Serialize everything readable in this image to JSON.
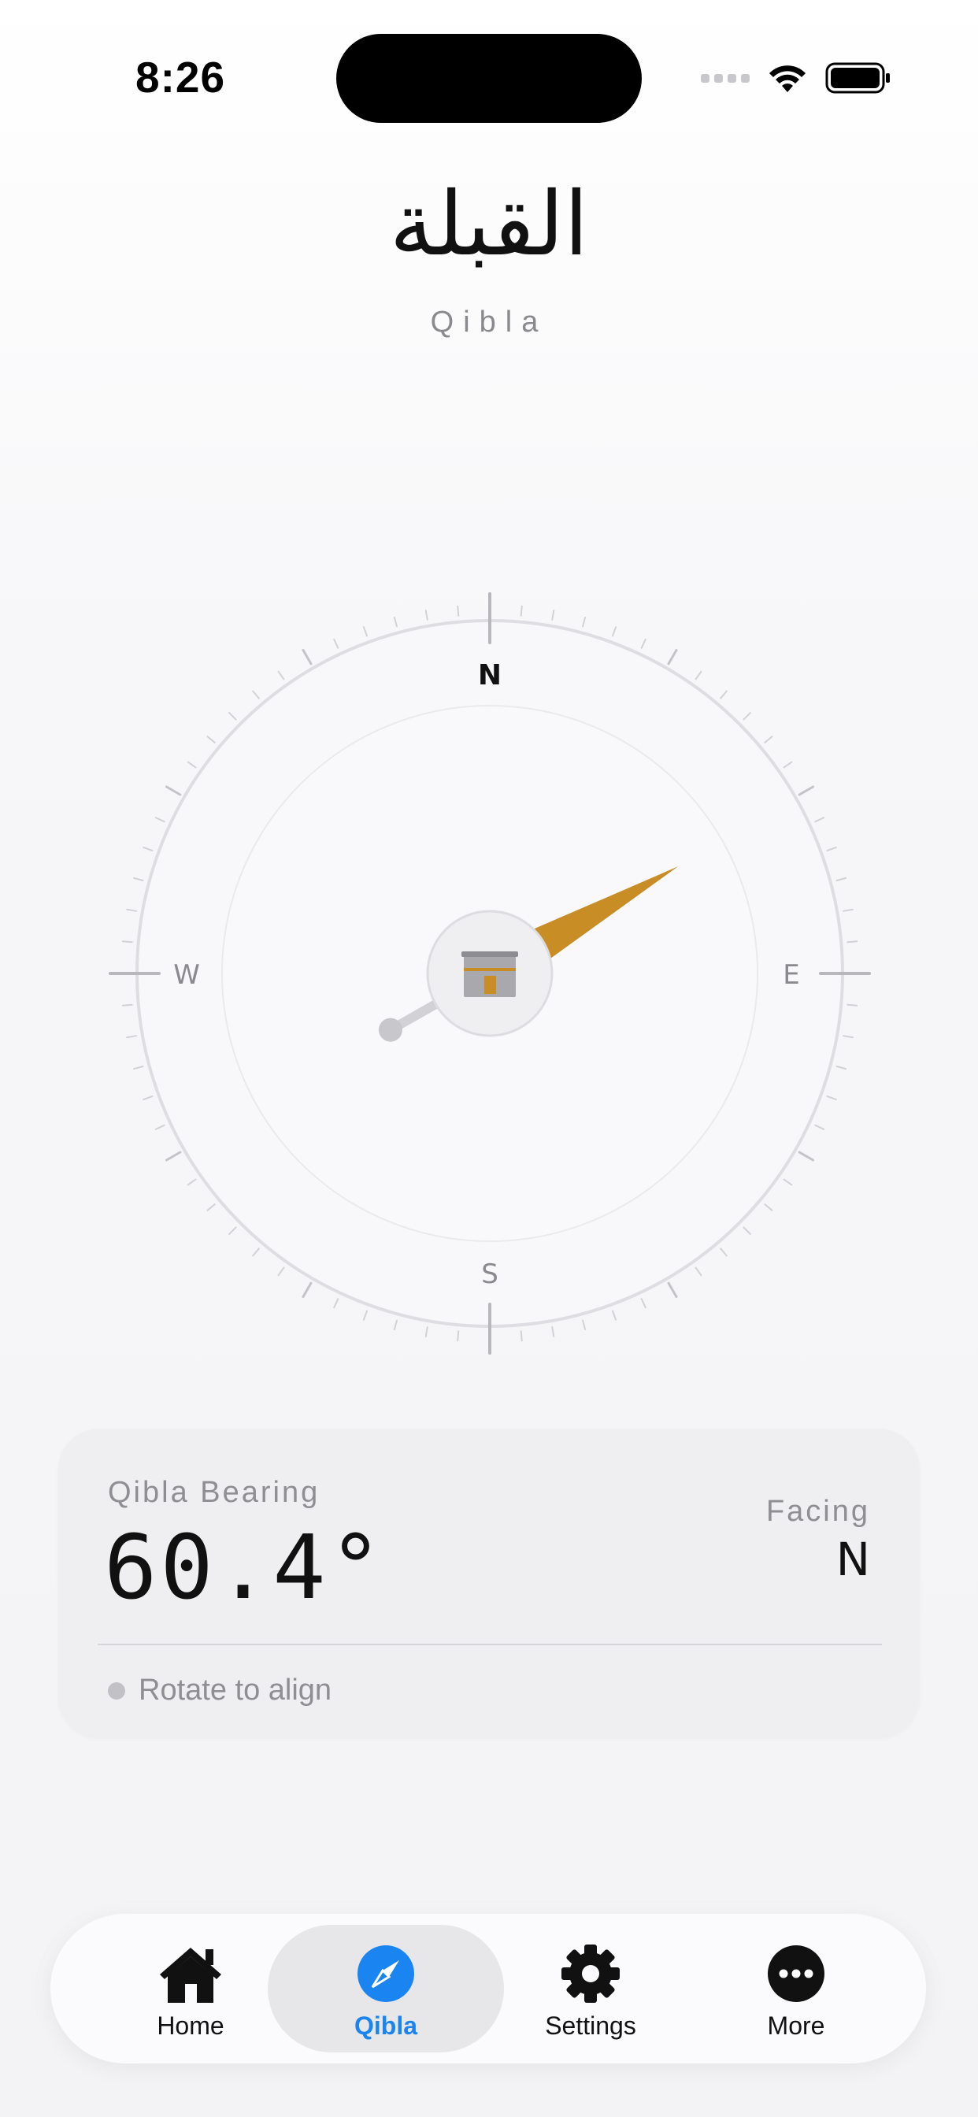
{
  "status_bar": {
    "time": "8:26"
  },
  "header": {
    "title_arabic": "القبلة",
    "title_english": "Qibla"
  },
  "compass": {
    "cardinals": {
      "north": "N",
      "east": "E",
      "south": "S",
      "west": "W"
    },
    "needle_bearing_deg": 60.4,
    "needle_color": "#c98d26"
  },
  "info_card": {
    "bearing_label": "Qibla Bearing",
    "bearing_value": "60.4°",
    "facing_label": "Facing",
    "facing_value": "N",
    "hint_text": "Rotate to align"
  },
  "tab_bar": {
    "active_tab": "Qibla",
    "accent_color": "#1a84f0",
    "items": [
      {
        "label": "Home",
        "icon": "home-icon"
      },
      {
        "label": "Qibla",
        "icon": "compass-icon"
      },
      {
        "label": "Settings",
        "icon": "gear-icon"
      },
      {
        "label": "More",
        "icon": "more-icon"
      }
    ]
  }
}
